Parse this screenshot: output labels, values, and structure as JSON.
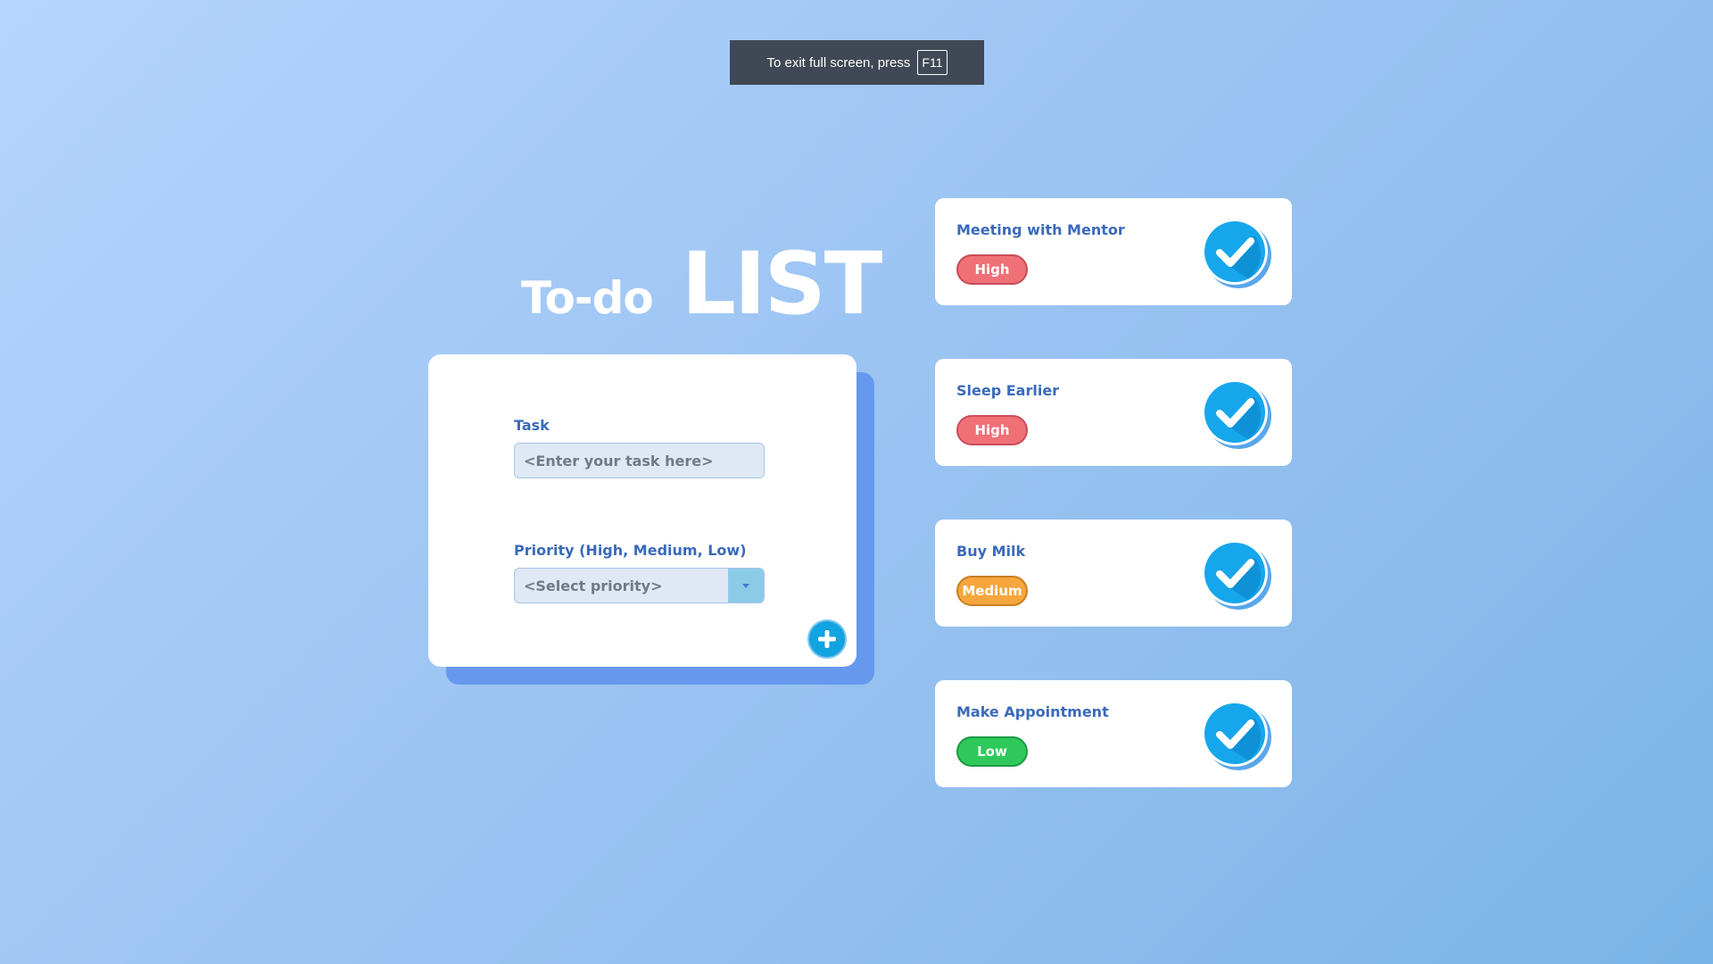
{
  "fullscreen_notice": {
    "text": "To exit full screen, press",
    "key": "F11"
  },
  "title": {
    "small": "To-do",
    "big": "LIST"
  },
  "form": {
    "task_label": "Task",
    "task_placeholder": "<Enter your task here>",
    "priority_label": "Priority (High, Medium, Low)",
    "priority_placeholder": "<Select priority>",
    "add_icon": "plus-icon"
  },
  "tasks": [
    {
      "name": "Meeting with Mentor",
      "priority": "High"
    },
    {
      "name": "Sleep Earlier",
      "priority": "High"
    },
    {
      "name": "Buy Milk",
      "priority": "Medium"
    },
    {
      "name": "Make Appointment",
      "priority": "Low"
    }
  ],
  "colors": {
    "accent": "#13a3e0",
    "label_text": "#3a6aba",
    "priority_high": "#f07078",
    "priority_medium": "#f6a63c",
    "priority_low": "#2ec95a"
  }
}
